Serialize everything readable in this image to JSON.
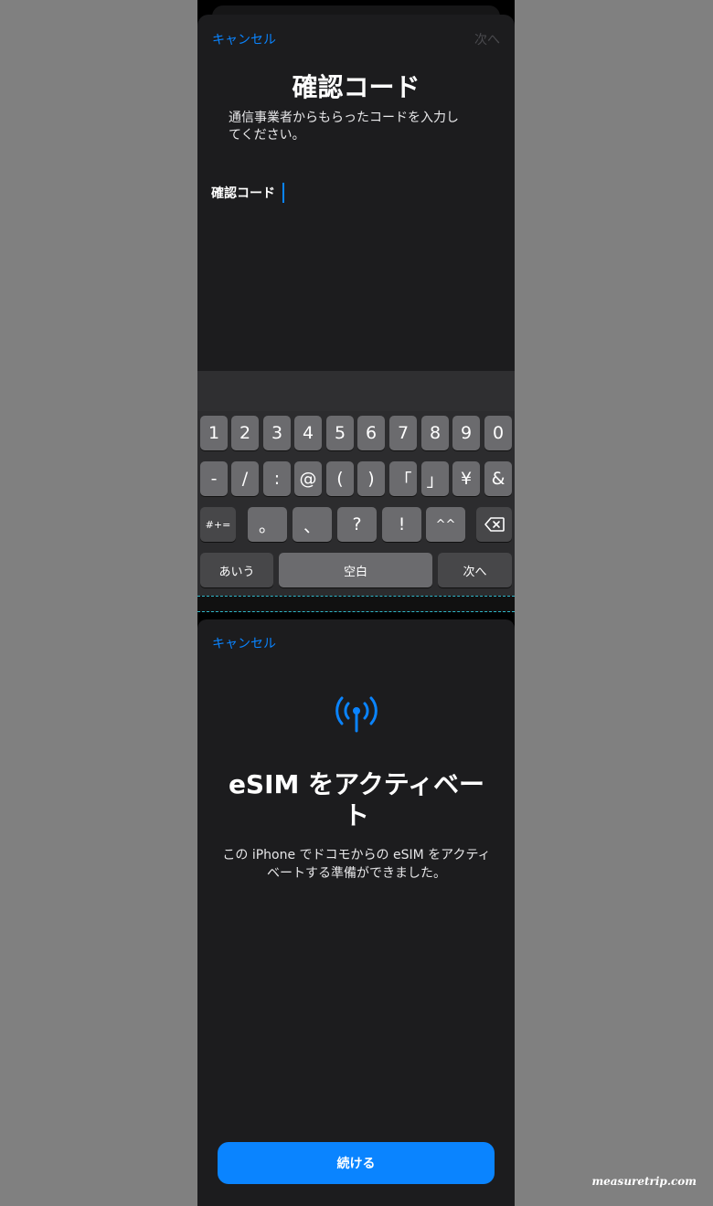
{
  "screen1": {
    "nav": {
      "cancel": "キャンセル",
      "next": "次へ"
    },
    "title": "確認コード",
    "subtitle_line1": "通信事業者からもらったコードを入力し",
    "subtitle_line2": "てください。",
    "code_field": {
      "label": "確認コード",
      "value": "",
      "placeholder": ""
    },
    "keyboard": {
      "row1": [
        "1",
        "2",
        "3",
        "4",
        "5",
        "6",
        "7",
        "8",
        "9",
        "0"
      ],
      "row2": [
        "-",
        "/",
        ":",
        "@",
        "(",
        ")",
        "「",
        "」",
        "¥",
        "&"
      ],
      "row3_left": "#+=",
      "row3": [
        "。",
        "、",
        "?",
        "!",
        "^^"
      ],
      "row3_right_icon": "delete-icon",
      "row4": {
        "left": "あいう",
        "space": "空白",
        "return": "次へ"
      }
    }
  },
  "screen2": {
    "cancel": "キャンセル",
    "icon": "antenna-signal-icon",
    "title_line1": "eSIM をアクティベー",
    "title_line2": "ト",
    "subtitle_line1": "この iPhone でドコモからの eSIM をアクティ",
    "subtitle_line2": "ベートする準備ができました。",
    "continue": "続ける"
  },
  "watermark": "measuretrip.com",
  "colors": {
    "accent": "#0a84ff",
    "sheet": "#1c1c1e",
    "key": "#6b6b6e",
    "key_dark": "#474749"
  }
}
